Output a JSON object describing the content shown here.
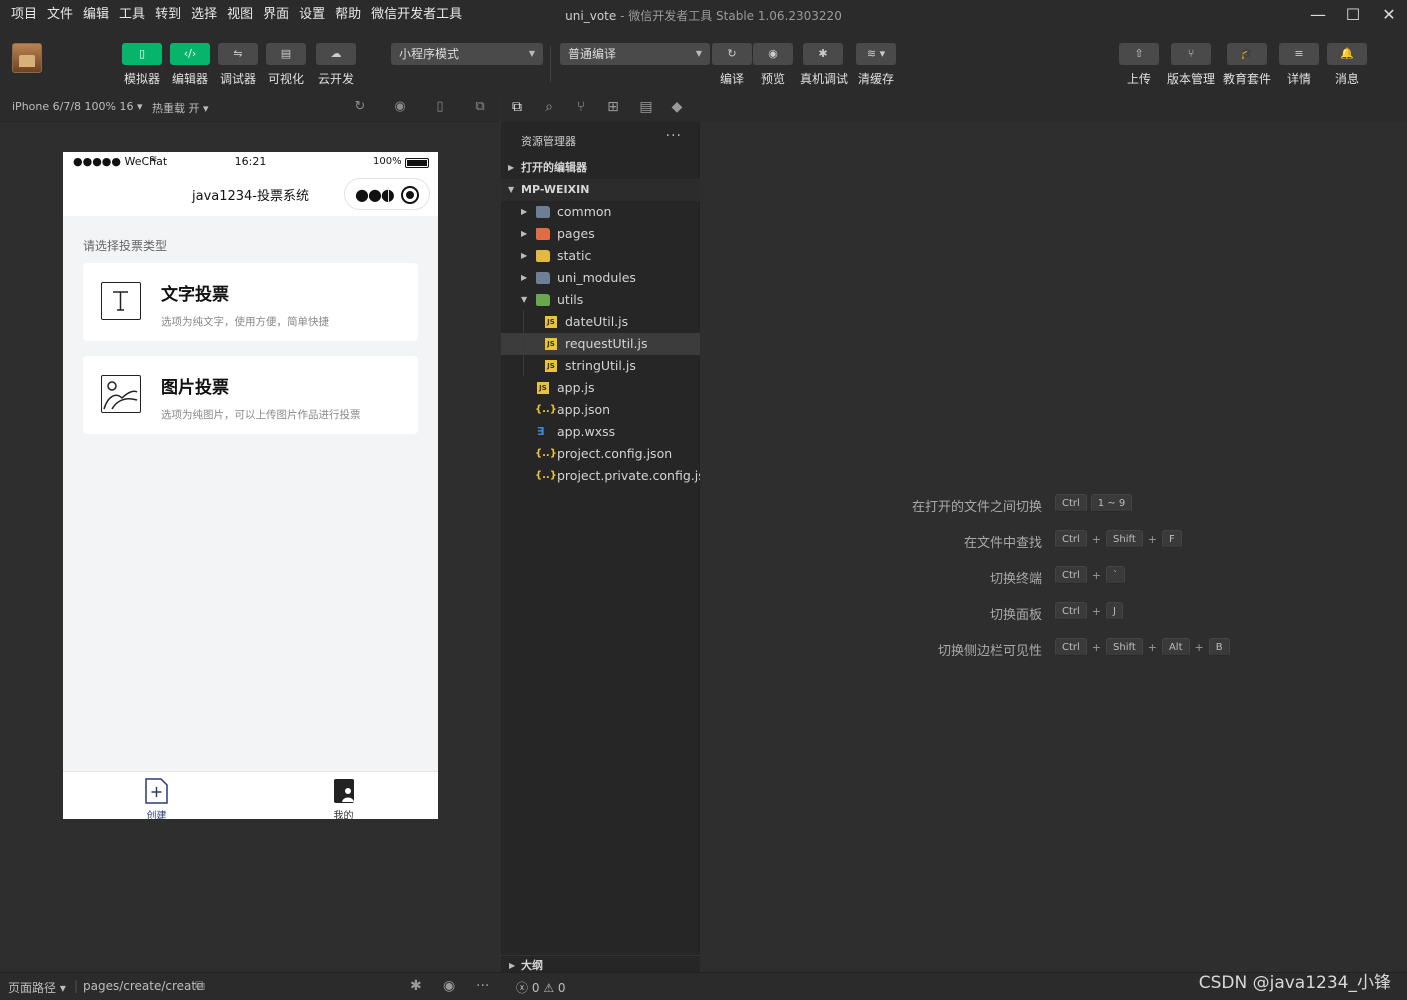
{
  "menu": {
    "items": [
      "项目",
      "文件",
      "编辑",
      "工具",
      "转到",
      "选择",
      "视图",
      "界面",
      "设置",
      "帮助",
      "微信开发者工具"
    ],
    "window_title_project": "uni_vote",
    "window_title_rest": " - 微信开发者工具 Stable 1.06.2303220"
  },
  "window_controls": {
    "minimize": "—",
    "maximize": "☐",
    "close": "✕"
  },
  "toolbar": {
    "simulator": "模拟器",
    "editor": "编辑器",
    "debugger": "调试器",
    "visual": "可视化",
    "cloud": "云开发",
    "mode_select": "小程序模式",
    "compile_select": "普通编译",
    "compile": "编译",
    "preview": "预览",
    "remote_debug": "真机调试",
    "clear_cache": "清缓存",
    "upload": "上传",
    "version": "版本管理",
    "education": "教育套件",
    "details": "详情",
    "messages": "消息"
  },
  "simulator": {
    "device": "iPhone 6/7/8 100% 16",
    "hot_reload": "热重载 开",
    "status_left": "●●●●● WeChat",
    "status_time": "16:21",
    "status_battery": "100%",
    "nav_title": "java1234-投票系统",
    "hint": "请选择投票类型",
    "cards": [
      {
        "title": "文字投票",
        "desc": "选项为纯文字，使用方便，简单快捷"
      },
      {
        "title": "图片投票",
        "desc": "选项为纯图片，可以上传图片作品进行投票"
      }
    ],
    "tabs": [
      {
        "label": "创建",
        "active": true
      },
      {
        "label": "我的",
        "active": false
      }
    ]
  },
  "explorer": {
    "title": "资源管理器",
    "more": "···",
    "open_editors": "打开的编辑器",
    "project": "MP-WEIXIN",
    "tree": [
      {
        "name": "common",
        "type": "folder"
      },
      {
        "name": "pages",
        "type": "folder"
      },
      {
        "name": "static",
        "type": "folder"
      },
      {
        "name": "uni_modules",
        "type": "folder"
      },
      {
        "name": "utils",
        "type": "folder-open"
      },
      {
        "name": "dateUtil.js",
        "type": "js"
      },
      {
        "name": "requestUtil.js",
        "type": "js",
        "selected": true
      },
      {
        "name": "stringUtil.js",
        "type": "js"
      },
      {
        "name": "app.js",
        "type": "js"
      },
      {
        "name": "app.json",
        "type": "json"
      },
      {
        "name": "app.wxss",
        "type": "css"
      },
      {
        "name": "project.config.json",
        "type": "json"
      },
      {
        "name": "project.private.config.js...",
        "type": "json"
      }
    ],
    "outline": "大纲"
  },
  "shortcuts": [
    {
      "label": "在打开的文件之间切换",
      "keys": [
        "Ctrl",
        "1 ~ 9"
      ]
    },
    {
      "label": "在文件中查找",
      "keys": [
        "Ctrl",
        "+",
        "Shift",
        "+",
        "F"
      ]
    },
    {
      "label": "切换终端",
      "keys": [
        "Ctrl",
        "+",
        "`"
      ]
    },
    {
      "label": "切换面板",
      "keys": [
        "Ctrl",
        "+",
        "J"
      ]
    },
    {
      "label": "切换侧边栏可见性",
      "keys": [
        "Ctrl",
        "+",
        "Shift",
        "+",
        "Alt",
        "+",
        "B"
      ]
    }
  ],
  "statusbar": {
    "page_path_label": "页面路径",
    "page_path": "pages/create/create",
    "errors": "0",
    "warnings": "0"
  },
  "watermark": "CSDN @java1234_小锋",
  "colors": {
    "accent_green": "#07b46b",
    "background": "#2e2e2e",
    "tab_active": "#2b3a78"
  }
}
